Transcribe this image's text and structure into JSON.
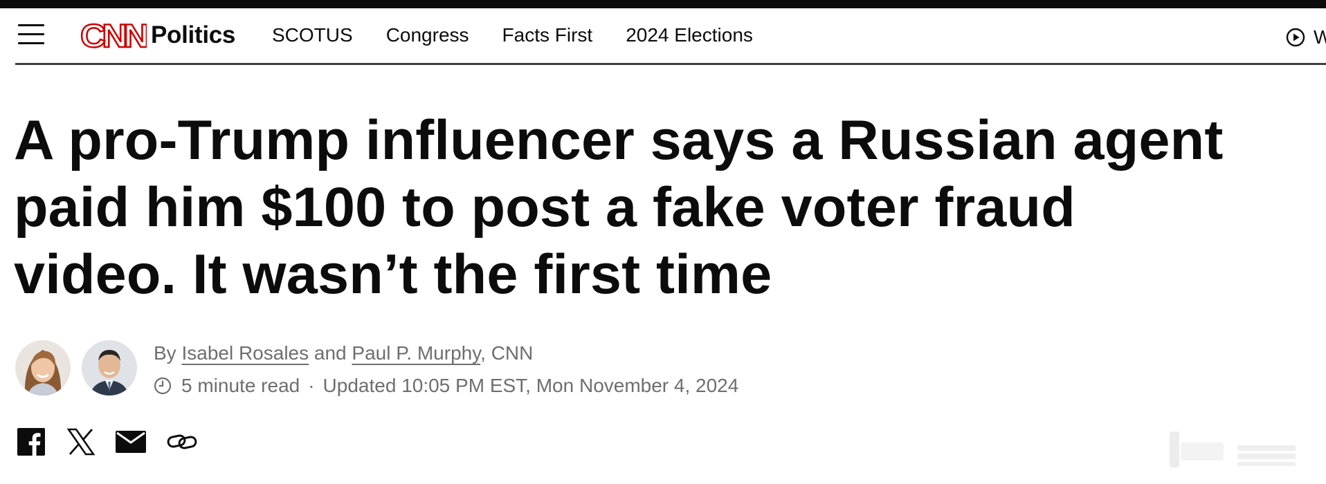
{
  "nav": {
    "menu_icon": "hamburger-menu-icon",
    "brand": "CNN",
    "section": "Politics",
    "links": [
      "SCOTUS",
      "Congress",
      "Facts First",
      "2024 Elections"
    ],
    "watch_icon": "play-circle-icon",
    "watch_label": "W"
  },
  "article": {
    "headline_lines": [
      "A pro-Trump influencer says a Russian agent",
      "paid him $100 to post a fake voter fraud",
      "video. It wasn’t the first time"
    ],
    "byline": {
      "prefix": "By",
      "author1": "Isabel Rosales",
      "joiner": "and",
      "author2": "Paul P. Murphy",
      "suffix": ", CNN"
    },
    "meta": {
      "read_time": "5 minute read",
      "separator": "·",
      "updated": "Updated 10:05 PM EST, Mon November 4, 2024"
    },
    "share_icons": [
      "facebook-icon",
      "x-icon",
      "email-icon",
      "link-icon"
    ]
  },
  "colors": {
    "brand_red": "#cc0000",
    "text": "#0c0c0c",
    "muted": "#6e6e6e",
    "rule": "#404040"
  }
}
